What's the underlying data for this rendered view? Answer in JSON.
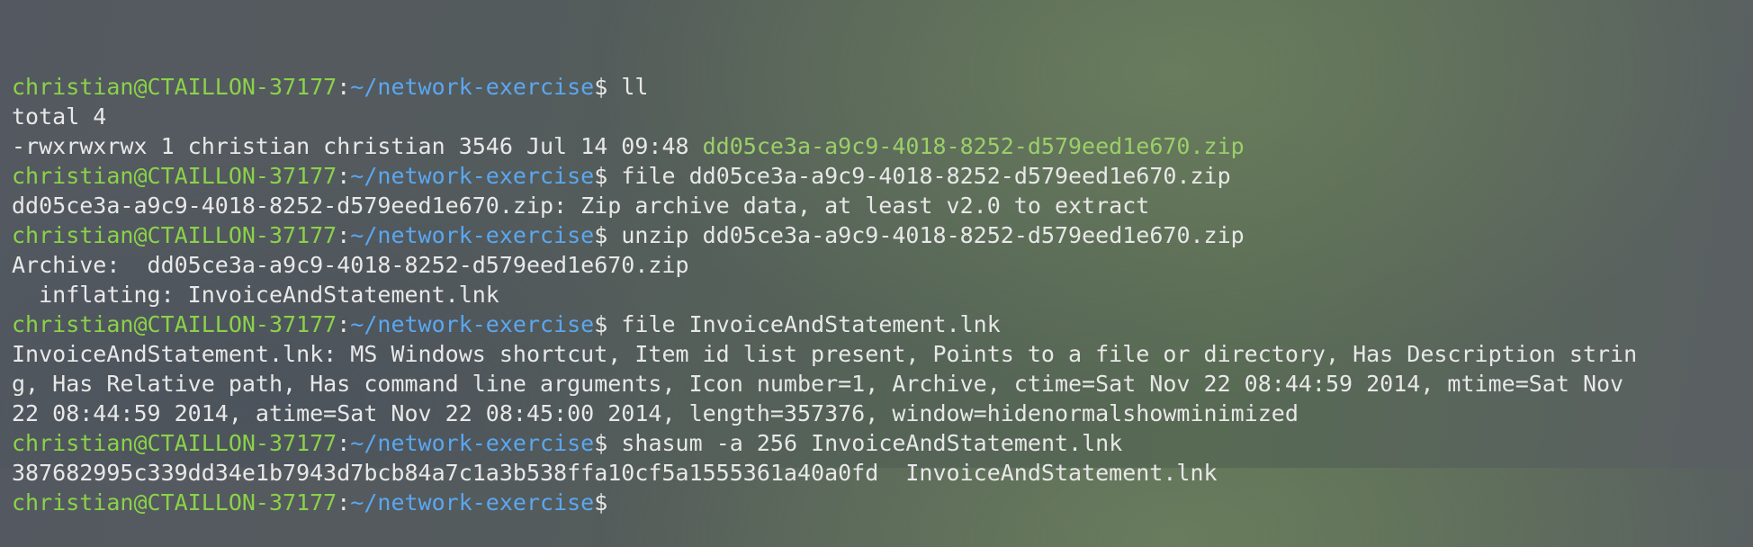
{
  "prompt": {
    "user_host": "christian@CTAILLON-37177",
    "path": "~/network-exercise",
    "symbol": "$"
  },
  "lines": [
    {
      "type": "prompt",
      "cmd": " ll"
    },
    {
      "type": "output",
      "text": "total 4"
    },
    {
      "type": "ls",
      "meta": "-rwxrwxrwx 1 christian christian 3546 Jul 14 09:48 ",
      "file": "dd05ce3a-a9c9-4018-8252-d579eed1e670.zip"
    },
    {
      "type": "prompt",
      "cmd": " file dd05ce3a-a9c9-4018-8252-d579eed1e670.zip"
    },
    {
      "type": "output",
      "text": "dd05ce3a-a9c9-4018-8252-d579eed1e670.zip: Zip archive data, at least v2.0 to extract"
    },
    {
      "type": "prompt",
      "cmd": " unzip dd05ce3a-a9c9-4018-8252-d579eed1e670.zip"
    },
    {
      "type": "output",
      "text": "Archive:  dd05ce3a-a9c9-4018-8252-d579eed1e670.zip"
    },
    {
      "type": "output",
      "text": "  inflating: InvoiceAndStatement.lnk"
    },
    {
      "type": "prompt",
      "cmd": " file InvoiceAndStatement.lnk"
    },
    {
      "type": "output",
      "text": "InvoiceAndStatement.lnk: MS Windows shortcut, Item id list present, Points to a file or directory, Has Description strin"
    },
    {
      "type": "output",
      "text": "g, Has Relative path, Has command line arguments, Icon number=1, Archive, ctime=Sat Nov 22 08:44:59 2014, mtime=Sat Nov"
    },
    {
      "type": "output",
      "text": "22 08:44:59 2014, atime=Sat Nov 22 08:45:00 2014, length=357376, window=hidenormalshowminimized"
    },
    {
      "type": "prompt",
      "cmd": " shasum -a 256 InvoiceAndStatement.lnk"
    },
    {
      "type": "output",
      "text": "387682995c339dd34e1b7943d7bcb84a7c1a3b538ffa10cf5a1555361a40a0fd  InvoiceAndStatement.lnk"
    },
    {
      "type": "prompt",
      "cmd": ""
    }
  ]
}
